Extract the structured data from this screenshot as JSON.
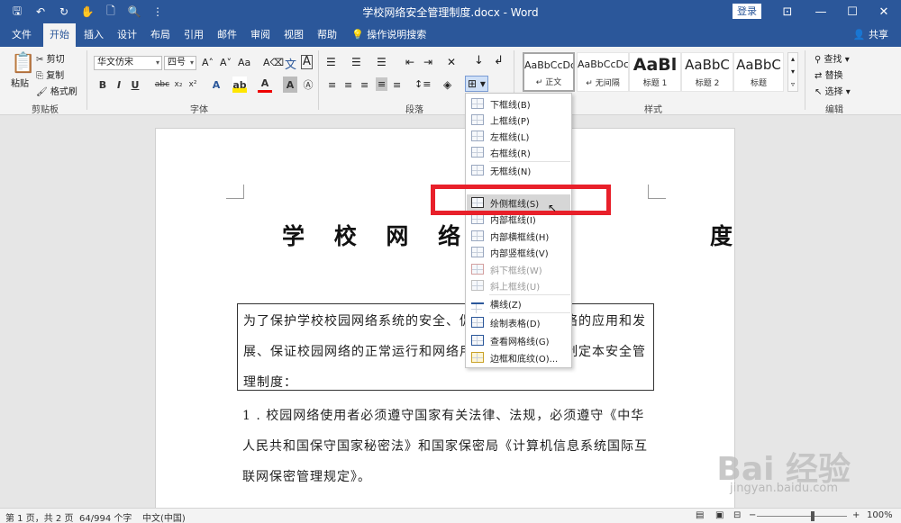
{
  "titlebar": {
    "doc_title": "学校网络安全管理制度.docx - Word",
    "login": "登录"
  },
  "tabs": [
    {
      "label": "文件",
      "active": false
    },
    {
      "label": "开始",
      "active": true
    },
    {
      "label": "插入",
      "active": false
    },
    {
      "label": "设计",
      "active": false
    },
    {
      "label": "布局",
      "active": false
    },
    {
      "label": "引用",
      "active": false
    },
    {
      "label": "邮件",
      "active": false
    },
    {
      "label": "审阅",
      "active": false
    },
    {
      "label": "视图",
      "active": false
    },
    {
      "label": "帮助",
      "active": false
    }
  ],
  "tell_me": "操作说明搜索",
  "share": "共享",
  "ribbon": {
    "clipboard": {
      "paste": "粘贴",
      "cut": "剪切",
      "copy": "复制",
      "format_painter": "格式刷",
      "label": "剪贴板"
    },
    "font": {
      "font_name": "华文仿宋",
      "font_size": "四号",
      "label": "字体"
    },
    "paragraph": {
      "label": "段落"
    },
    "styles": {
      "items": [
        {
          "sample": "AaBbCcDc",
          "name": "正文"
        },
        {
          "sample": "AaBbCcDc",
          "name": "无间隔"
        },
        {
          "sample": "AaBl",
          "name": "标题 1"
        },
        {
          "sample": "AaBbC",
          "name": "标题 2"
        },
        {
          "sample": "AaBbC",
          "name": "标题"
        }
      ],
      "label": "样式"
    },
    "editing": {
      "find": "查找",
      "replace": "替换",
      "select": "选择",
      "label": "编辑"
    }
  },
  "border_menu": {
    "items": [
      {
        "label": "下框线(B)",
        "disabled": false
      },
      {
        "label": "上框线(P)",
        "disabled": false
      },
      {
        "label": "左框线(L)",
        "disabled": false
      },
      {
        "label": "右框线(R)",
        "disabled": false
      },
      {
        "label": "无框线(N)",
        "disabled": false
      },
      {
        "label": "外侧框线(S)",
        "disabled": false,
        "highlighted": true
      },
      {
        "label": "内部框线(I)",
        "disabled": false
      },
      {
        "label": "内部横框线(H)",
        "disabled": false
      },
      {
        "label": "内部竖框线(V)",
        "disabled": false
      },
      {
        "label": "斜下框线(W)",
        "disabled": true
      },
      {
        "label": "斜上框线(U)",
        "disabled": true
      },
      {
        "label": "横线(Z)",
        "disabled": false
      },
      {
        "label": "绘制表格(D)",
        "disabled": false
      },
      {
        "label": "查看网格线(G)",
        "disabled": false
      },
      {
        "label": "边框和底纹(O)...",
        "disabled": false
      }
    ]
  },
  "document": {
    "heading": "学 校 网 络 安 全",
    "heading_tail": "度",
    "boxed_lines": [
      "为了保护学校校园网络系统的安全、促",
      "展、保证校园网络的正常运行和网络用",
      "理制度："
    ],
    "boxed_right": [
      "络的应用和发",
      "制定本安全管"
    ],
    "para_lines": [
      "1 . 校园网络使用者必须遵守国家有关法律、法规，必须遵守《中华",
      "人民共和国保守国家秘密法》和国家保密局《计算机信息系统国际互",
      "联网保密管理规定》。"
    ]
  },
  "status": {
    "page": "第 1 页，共 2 页",
    "words": "64/994 个字",
    "lang": "中文(中国)",
    "zoom": "100%"
  },
  "watermark": {
    "main": "Bai 经验",
    "sub": "jingyan.baidu.com"
  }
}
